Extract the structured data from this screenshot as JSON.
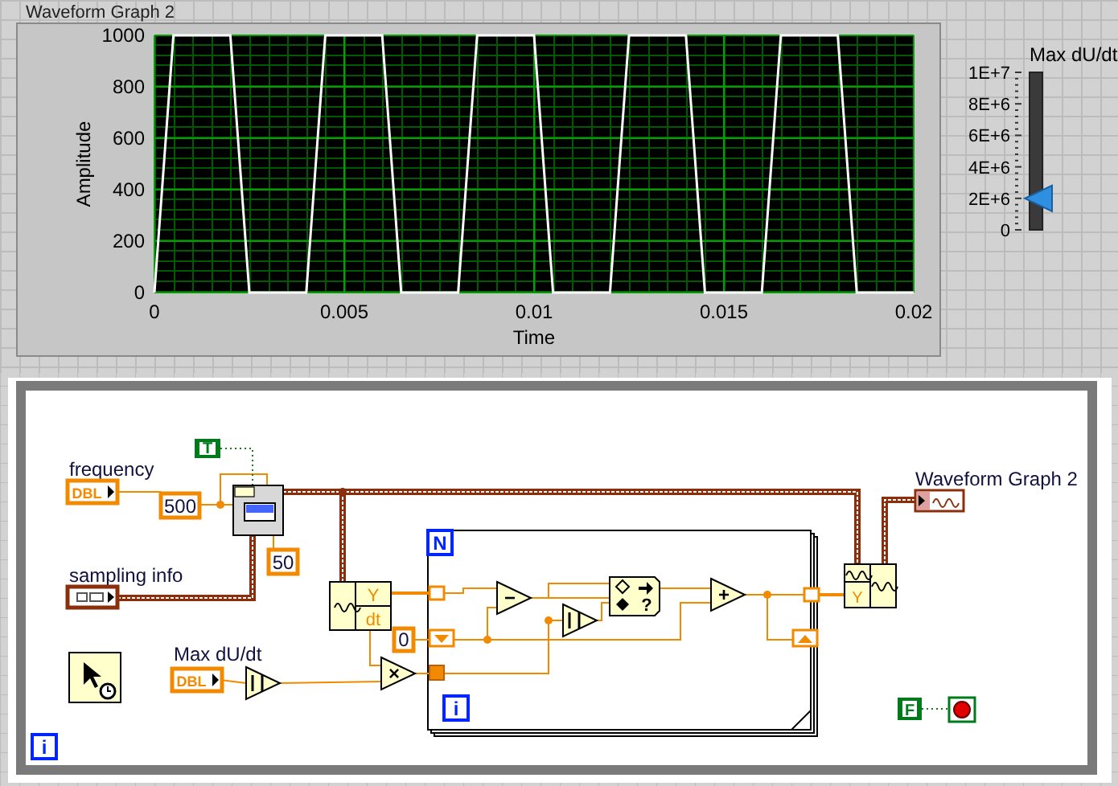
{
  "front_panel": {
    "graph": {
      "label": "Waveform Graph 2",
      "chart_data": {
        "type": "line",
        "grid": true,
        "xlabel": "Time",
        "ylabel": "Amplitude",
        "x": [
          0,
          0.0005,
          0.002,
          0.0025,
          0.004,
          0.0045,
          0.006,
          0.0065,
          0.008,
          0.0085,
          0.01,
          0.0105,
          0.012,
          0.0125,
          0.014,
          0.0145,
          0.016,
          0.0165,
          0.018,
          0.0185,
          0.02
        ],
        "series": [
          {
            "color": "#ffffff",
            "values": [
              0,
              1000,
              1000,
              0,
              0,
              1000,
              1000,
              0,
              0,
              1000,
              1000,
              0,
              0,
              1000,
              1000,
              0,
              0,
              1000,
              1000,
              0,
              0
            ]
          }
        ],
        "xlim": [
          0,
          0.02
        ],
        "ylim": [
          0,
          1000
        ],
        "xticks": [
          0,
          0.005,
          0.01,
          0.015,
          0.02
        ],
        "yticks": [
          0,
          200,
          400,
          600,
          800,
          1000
        ]
      }
    },
    "slider": {
      "label": "Max dU/dt",
      "ticks": [
        "1E+7",
        "8E+6",
        "6E+6",
        "4E+6",
        "2E+6",
        "0"
      ],
      "level": 0.2
    }
  },
  "block_diagram": {
    "terminals": [
      {
        "kind": "numeric",
        "label": "frequency",
        "type": "DBL"
      },
      {
        "kind": "cluster",
        "label": "sampling info"
      },
      {
        "kind": "numeric",
        "label": "Max dU/dt",
        "type": "DBL"
      },
      {
        "kind": "graph",
        "label": "Waveform Graph 2"
      }
    ],
    "constants": [
      {
        "kind": "boolean",
        "value": "T"
      },
      {
        "kind": "numeric",
        "value": "500"
      },
      {
        "kind": "numeric",
        "value": "50"
      },
      {
        "kind": "numeric",
        "value": "0"
      },
      {
        "kind": "boolean",
        "value": "F"
      }
    ],
    "waveform_nodes": [
      {
        "kind": "get",
        "fields": [
          "Y",
          "dt"
        ]
      },
      {
        "kind": "build",
        "fields": [
          "Y"
        ]
      }
    ],
    "operators": [
      {
        "kind": "abs"
      },
      {
        "kind": "multiply",
        "symbol": "×"
      },
      {
        "kind": "subtract",
        "symbol": "−"
      },
      {
        "kind": "abs"
      },
      {
        "kind": "select",
        "symbol": "?"
      },
      {
        "kind": "add",
        "symbol": "+"
      }
    ],
    "loop_labels": {
      "count": "N",
      "for_index": "i",
      "while_index": "i"
    }
  }
}
